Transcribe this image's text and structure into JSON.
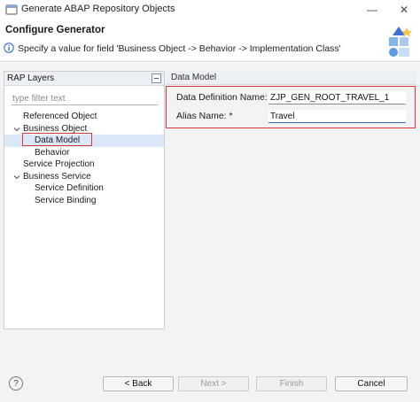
{
  "window": {
    "title": "Generate ABAP Repository Objects",
    "minimize_glyph": "—",
    "close_glyph": "✕"
  },
  "banner": {
    "title": "Configure Generator",
    "message": "Specify a value for field 'Business Object -> Behavior -> Implementation Class'",
    "message_icon": "info-icon"
  },
  "left_panel": {
    "header": "RAP Layers",
    "filter_placeholder": "type filter text",
    "tree": [
      {
        "label": "Referenced Object",
        "level": 0,
        "expandable": false
      },
      {
        "label": "Business Object",
        "level": 0,
        "expandable": true,
        "expanded": true
      },
      {
        "label": "Data Model",
        "level": 1,
        "expandable": false,
        "selected": true
      },
      {
        "label": "Behavior",
        "level": 1,
        "expandable": false
      },
      {
        "label": "Service Projection",
        "level": 0,
        "expandable": false
      },
      {
        "label": "Business Service",
        "level": 0,
        "expandable": true,
        "expanded": true
      },
      {
        "label": "Service Definition",
        "level": 1,
        "expandable": false
      },
      {
        "label": "Service Binding",
        "level": 1,
        "expandable": false
      }
    ]
  },
  "right_panel": {
    "header": "Data Model",
    "fields": [
      {
        "label": "Data Definition Name: *",
        "value": "ZJP_GEN_ROOT_TRAVEL_1"
      },
      {
        "label": "Alias Name: *",
        "value": "Travel"
      }
    ]
  },
  "buttons": {
    "help": "?",
    "back": "< Back",
    "next": "Next >",
    "finish": "Finish",
    "cancel": "Cancel"
  },
  "colors": {
    "annotation_red": "#d9393a",
    "selection": "#dbe8f7",
    "panel_header": "#eceff3"
  }
}
